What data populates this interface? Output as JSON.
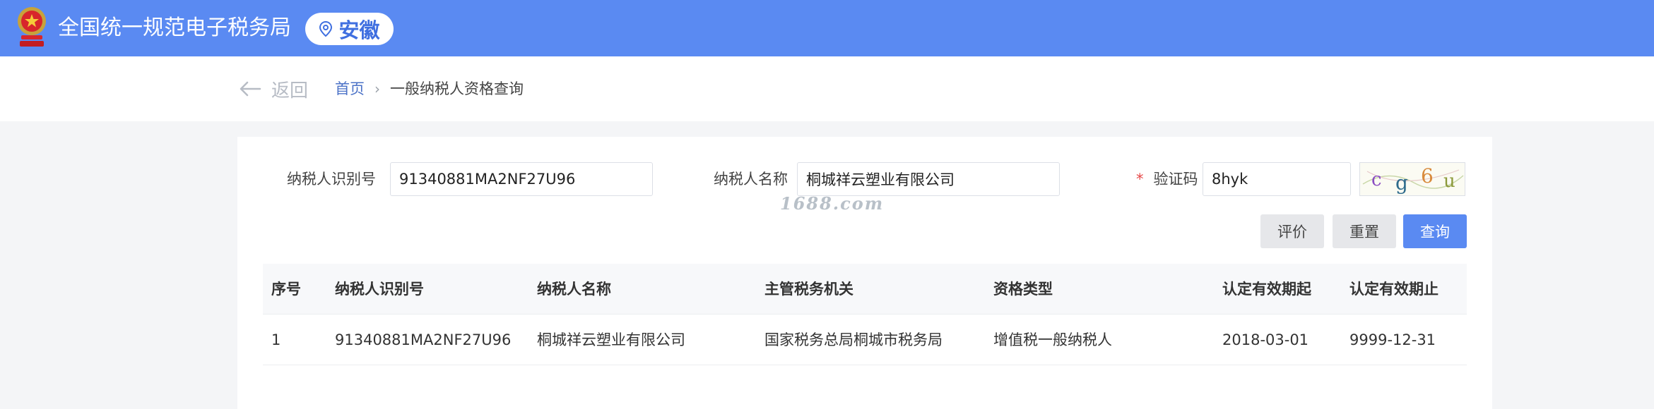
{
  "header": {
    "site_title": "全国统一规范电子税务局",
    "region": "安徽",
    "emblem_icon": "national-emblem-icon",
    "location_icon": "location-pin-icon",
    "bg_color": "#5a8af2"
  },
  "nav": {
    "back_label": "返回",
    "breadcrumb": {
      "home": "首页",
      "separator": "›",
      "current": "一般纳税人资格查询"
    }
  },
  "form": {
    "taxpayer_id": {
      "label": "纳税人识别号",
      "value": "91340881MA2NF27U96"
    },
    "taxpayer_name": {
      "label": "纳税人名称",
      "value": "桐城祥云塑业有限公司"
    },
    "captcha": {
      "required_mark": "*",
      "label": "验证码",
      "value": "8hyk",
      "image_chars": [
        "c",
        "g",
        "6",
        "u"
      ]
    },
    "watermark": "1688.com"
  },
  "buttons": {
    "evaluate": "评价",
    "reset": "重置",
    "query": "查询"
  },
  "table": {
    "columns": [
      "序号",
      "纳税人识别号",
      "纳税人名称",
      "主管税务机关",
      "资格类型",
      "认定有效期起",
      "认定有效期止"
    ],
    "rows": [
      [
        "1",
        "91340881MA2NF27U96",
        "桐城祥云塑业有限公司",
        "国家税务总局桐城市税务局",
        "增值税一般纳税人",
        "2018-03-01",
        "9999-12-31"
      ]
    ]
  }
}
